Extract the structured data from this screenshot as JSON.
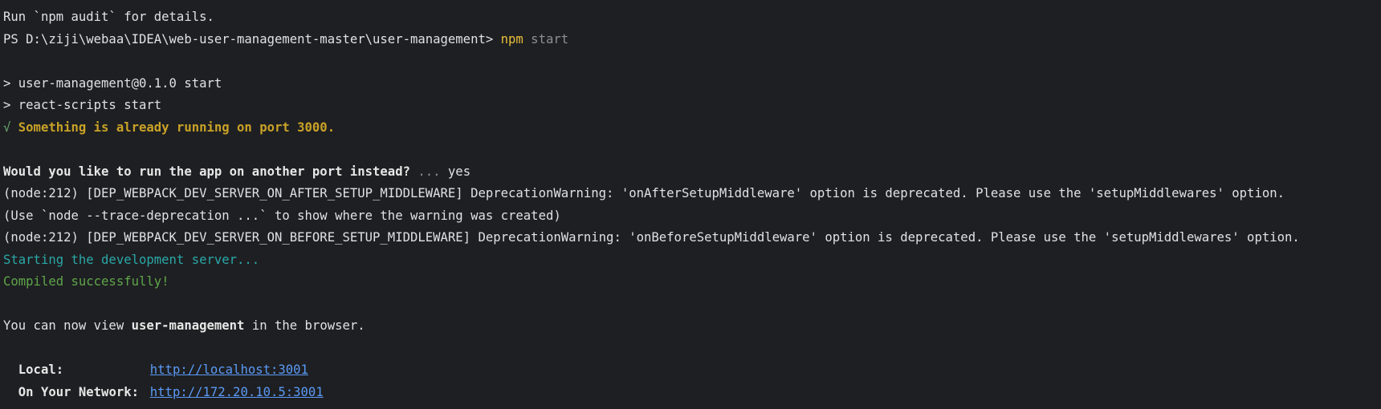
{
  "lines": {
    "l1": "Run `npm audit` for details.",
    "l2_prompt": "PS D:\\ziji\\webaa\\IDEA\\web-user-management-master\\user-management> ",
    "l2_cmd": "npm",
    "l2_arg": " start",
    "l3": "> user-management@0.1.0 start",
    "l4": "> react-scripts start",
    "l5_tick": "√ ",
    "l5_msg": "Something is already running on port 3000.",
    "l6_q": "Would you like to run the app on another port instead?",
    "l6_dots": " ...",
    "l6_ans": " yes",
    "l7": "(node:212) [DEP_WEBPACK_DEV_SERVER_ON_AFTER_SETUP_MIDDLEWARE] DeprecationWarning: 'onAfterSetupMiddleware' option is deprecated. Please use the 'setupMiddlewares' option.",
    "l8": "(Use `node --trace-deprecation ...` to show where the warning was created)",
    "l9": "(node:212) [DEP_WEBPACK_DEV_SERVER_ON_BEFORE_SETUP_MIDDLEWARE] DeprecationWarning: 'onBeforeSetupMiddleware' option is deprecated. Please use the 'setupMiddlewares' option.",
    "l10": "Starting the development server...",
    "l11": "Compiled successfully!",
    "l12_a": "You can now view ",
    "l12_b": "user-management",
    "l12_c": " in the browser.",
    "local_label": "Local:",
    "local_url": "http://localhost:3001",
    "network_label": "On Your Network:",
    "network_url": "http://172.20.10.5:3001"
  },
  "colors": {
    "background": "#1e1f22",
    "text": "#dfe1e5",
    "npm_command": "#e8bf3c",
    "warning": "#c9a227",
    "info_cyan": "#2aa8a8",
    "success_green": "#5fa64a",
    "link": "#5a9af5"
  }
}
